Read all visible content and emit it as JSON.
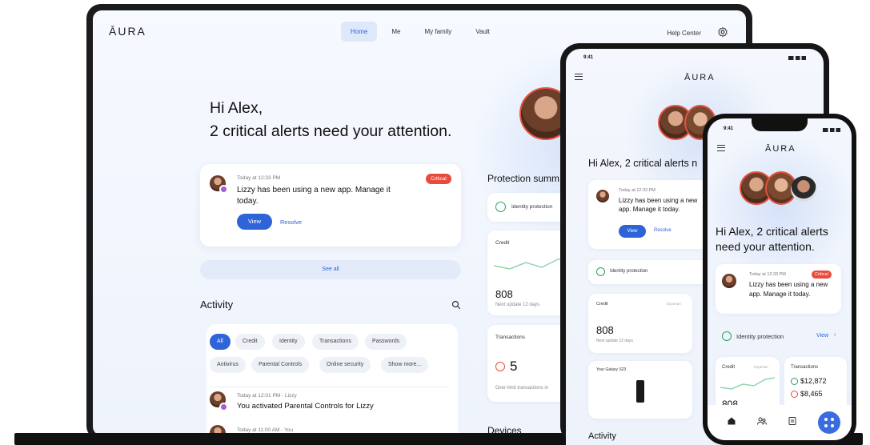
{
  "laptop": {
    "logo": "ĀURA",
    "nav": {
      "tabs": [
        "Home",
        "Me",
        "My family",
        "Vault"
      ],
      "active": "Home",
      "help": "Help Center"
    },
    "greeting": {
      "line1": "Hi Alex,",
      "line2": "2 critical alerts need your attention."
    },
    "alert": {
      "time": "Today at 12:33 PM",
      "badge": "Critical",
      "message": "Lizzy has been using a new app. Manage it today.",
      "view": "View",
      "resolve": "Resolve"
    },
    "see_all": "See all",
    "activity": {
      "title": "Activity",
      "chips": [
        "All",
        "Credit",
        "Identity",
        "Transactions",
        "Passwords",
        "Antivirus",
        "Parental Controls",
        "Online security",
        "Show more..."
      ],
      "items": [
        {
          "time": "Today at 12:01 PM - Lizzy",
          "text": "You activated Parental Controls for Lizzy"
        },
        {
          "time": "Today at 11:00 AM - You",
          "text": ""
        }
      ]
    },
    "protection": {
      "title": "Protection summ",
      "identity": "Identity protection",
      "credit": {
        "label": "Credit",
        "score": "808",
        "sub": "Next update 12 days"
      },
      "transactions": {
        "label": "Transactions",
        "count": "5",
        "sub": "Over-limit transactions in"
      }
    },
    "devices": "Devices"
  },
  "tablet": {
    "time": "9:41",
    "logo": "ĀURA",
    "greeting": "Hi Alex, 2 critical alerts n",
    "alert": {
      "time": "Today at 12:33 PM",
      "message": "Lizzy has been using a new app. Manage it today.",
      "view": "View",
      "resolve": "Resolve"
    },
    "identity": "Identity protection",
    "credit": {
      "label": "Credit",
      "tag": "Experian",
      "score": "808",
      "sub": "Next update 12 days"
    },
    "device": "Your Galaxy S23",
    "activity": "Activity"
  },
  "phone": {
    "time": "9:41",
    "logo": "ĀURA",
    "greeting": "Hi Alex, 2 critical alerts need your attention.",
    "alert": {
      "time": "Today at 12:33 PM",
      "badge": "Critical",
      "message": "Lizzy has been using a new app. Manage it today."
    },
    "identity": {
      "label": "Identity protection",
      "link": "View"
    },
    "credit": {
      "label": "Credit",
      "tag": "Experian",
      "score": "808"
    },
    "transactions": {
      "label": "Transactions",
      "items": [
        "$12,872",
        "$8,465"
      ]
    }
  },
  "colors": {
    "accent": "#2f64d8",
    "critical": "#e84b3c",
    "success": "#2e9e62",
    "chart_line": "#8fd6b0"
  }
}
